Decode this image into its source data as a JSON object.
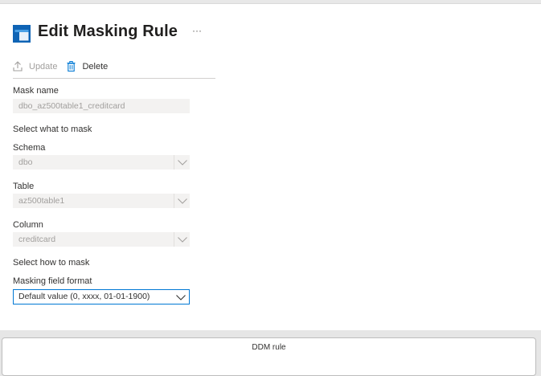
{
  "header": {
    "title": "Edit Masking Rule",
    "more_label": "···"
  },
  "toolbar": {
    "update_label": "Update",
    "delete_label": "Delete"
  },
  "form": {
    "mask_name_label": "Mask name",
    "mask_name_value": "dbo_az500table1_creditcard",
    "select_what_label": "Select what to mask",
    "schema_label": "Schema",
    "schema_value": "dbo",
    "table_label": "Table",
    "table_value": "az500table1",
    "column_label": "Column",
    "column_value": "creditcard",
    "select_how_label": "Select how to mask",
    "format_label": "Masking field format",
    "format_value": "Default value (0, xxxx, 01-01-1900)"
  },
  "footer": {
    "ddm_label": "DDM rule"
  },
  "colors": {
    "accent": "#0078d4",
    "disabled_text": "#a19f9d",
    "field_bg": "#f3f2f1"
  }
}
